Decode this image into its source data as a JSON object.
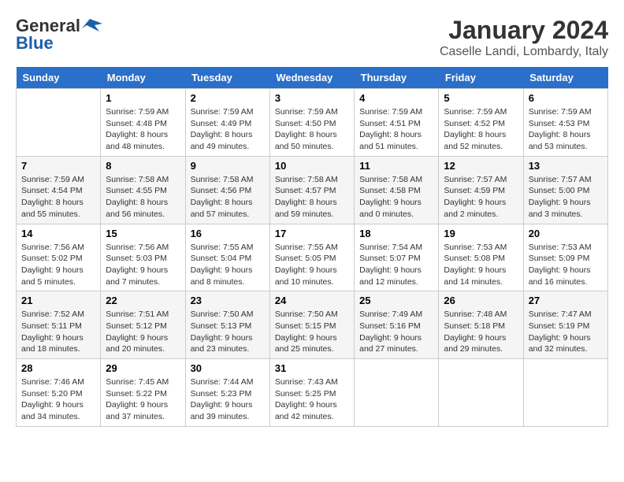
{
  "header": {
    "logo_line1": "General",
    "logo_line2": "Blue",
    "month_year": "January 2024",
    "location": "Caselle Landi, Lombardy, Italy"
  },
  "days_of_week": [
    "Sunday",
    "Monday",
    "Tuesday",
    "Wednesday",
    "Thursday",
    "Friday",
    "Saturday"
  ],
  "weeks": [
    [
      {
        "date": "",
        "info": ""
      },
      {
        "date": "1",
        "info": "Sunrise: 7:59 AM\nSunset: 4:48 PM\nDaylight: 8 hours\nand 48 minutes."
      },
      {
        "date": "2",
        "info": "Sunrise: 7:59 AM\nSunset: 4:49 PM\nDaylight: 8 hours\nand 49 minutes."
      },
      {
        "date": "3",
        "info": "Sunrise: 7:59 AM\nSunset: 4:50 PM\nDaylight: 8 hours\nand 50 minutes."
      },
      {
        "date": "4",
        "info": "Sunrise: 7:59 AM\nSunset: 4:51 PM\nDaylight: 8 hours\nand 51 minutes."
      },
      {
        "date": "5",
        "info": "Sunrise: 7:59 AM\nSunset: 4:52 PM\nDaylight: 8 hours\nand 52 minutes."
      },
      {
        "date": "6",
        "info": "Sunrise: 7:59 AM\nSunset: 4:53 PM\nDaylight: 8 hours\nand 53 minutes."
      }
    ],
    [
      {
        "date": "7",
        "info": "Sunrise: 7:59 AM\nSunset: 4:54 PM\nDaylight: 8 hours\nand 55 minutes."
      },
      {
        "date": "8",
        "info": "Sunrise: 7:58 AM\nSunset: 4:55 PM\nDaylight: 8 hours\nand 56 minutes."
      },
      {
        "date": "9",
        "info": "Sunrise: 7:58 AM\nSunset: 4:56 PM\nDaylight: 8 hours\nand 57 minutes."
      },
      {
        "date": "10",
        "info": "Sunrise: 7:58 AM\nSunset: 4:57 PM\nDaylight: 8 hours\nand 59 minutes."
      },
      {
        "date": "11",
        "info": "Sunrise: 7:58 AM\nSunset: 4:58 PM\nDaylight: 9 hours\nand 0 minutes."
      },
      {
        "date": "12",
        "info": "Sunrise: 7:57 AM\nSunset: 4:59 PM\nDaylight: 9 hours\nand 2 minutes."
      },
      {
        "date": "13",
        "info": "Sunrise: 7:57 AM\nSunset: 5:00 PM\nDaylight: 9 hours\nand 3 minutes."
      }
    ],
    [
      {
        "date": "14",
        "info": "Sunrise: 7:56 AM\nSunset: 5:02 PM\nDaylight: 9 hours\nand 5 minutes."
      },
      {
        "date": "15",
        "info": "Sunrise: 7:56 AM\nSunset: 5:03 PM\nDaylight: 9 hours\nand 7 minutes."
      },
      {
        "date": "16",
        "info": "Sunrise: 7:55 AM\nSunset: 5:04 PM\nDaylight: 9 hours\nand 8 minutes."
      },
      {
        "date": "17",
        "info": "Sunrise: 7:55 AM\nSunset: 5:05 PM\nDaylight: 9 hours\nand 10 minutes."
      },
      {
        "date": "18",
        "info": "Sunrise: 7:54 AM\nSunset: 5:07 PM\nDaylight: 9 hours\nand 12 minutes."
      },
      {
        "date": "19",
        "info": "Sunrise: 7:53 AM\nSunset: 5:08 PM\nDaylight: 9 hours\nand 14 minutes."
      },
      {
        "date": "20",
        "info": "Sunrise: 7:53 AM\nSunset: 5:09 PM\nDaylight: 9 hours\nand 16 minutes."
      }
    ],
    [
      {
        "date": "21",
        "info": "Sunrise: 7:52 AM\nSunset: 5:11 PM\nDaylight: 9 hours\nand 18 minutes."
      },
      {
        "date": "22",
        "info": "Sunrise: 7:51 AM\nSunset: 5:12 PM\nDaylight: 9 hours\nand 20 minutes."
      },
      {
        "date": "23",
        "info": "Sunrise: 7:50 AM\nSunset: 5:13 PM\nDaylight: 9 hours\nand 23 minutes."
      },
      {
        "date": "24",
        "info": "Sunrise: 7:50 AM\nSunset: 5:15 PM\nDaylight: 9 hours\nand 25 minutes."
      },
      {
        "date": "25",
        "info": "Sunrise: 7:49 AM\nSunset: 5:16 PM\nDaylight: 9 hours\nand 27 minutes."
      },
      {
        "date": "26",
        "info": "Sunrise: 7:48 AM\nSunset: 5:18 PM\nDaylight: 9 hours\nand 29 minutes."
      },
      {
        "date": "27",
        "info": "Sunrise: 7:47 AM\nSunset: 5:19 PM\nDaylight: 9 hours\nand 32 minutes."
      }
    ],
    [
      {
        "date": "28",
        "info": "Sunrise: 7:46 AM\nSunset: 5:20 PM\nDaylight: 9 hours\nand 34 minutes."
      },
      {
        "date": "29",
        "info": "Sunrise: 7:45 AM\nSunset: 5:22 PM\nDaylight: 9 hours\nand 37 minutes."
      },
      {
        "date": "30",
        "info": "Sunrise: 7:44 AM\nSunset: 5:23 PM\nDaylight: 9 hours\nand 39 minutes."
      },
      {
        "date": "31",
        "info": "Sunrise: 7:43 AM\nSunset: 5:25 PM\nDaylight: 9 hours\nand 42 minutes."
      },
      {
        "date": "",
        "info": ""
      },
      {
        "date": "",
        "info": ""
      },
      {
        "date": "",
        "info": ""
      }
    ]
  ]
}
